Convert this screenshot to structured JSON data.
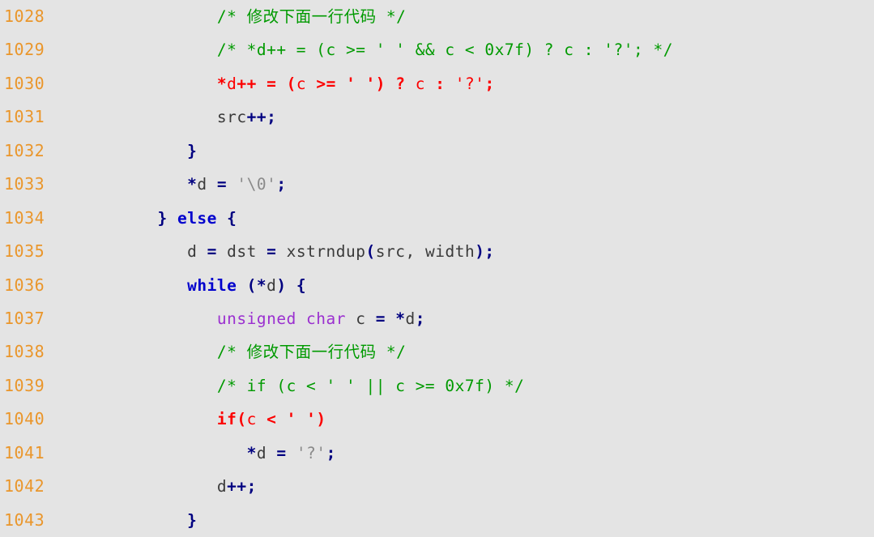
{
  "editor": {
    "name": "source-code-view",
    "background_color": "#e4e4e4",
    "gutter_color": "#ea962b",
    "font": "monospace",
    "first_line": 1028,
    "last_line": 1043,
    "colors": {
      "comment": "#009a00",
      "highlight": "#fc0000",
      "operator": "#000080",
      "keyword": "#0000cd",
      "type": "#9b30d0",
      "string": "#8a8a8a",
      "identifier": "#3a3a3a",
      "line_number": "#ea962b",
      "background": "#e4e4e4"
    }
  },
  "lines": [
    {
      "number": "1028",
      "text": "            /* 修改下面一行代码 */",
      "tokens": [
        {
          "t": "            ",
          "c": "plain"
        },
        {
          "t": "/* 修改下面一行代码 */",
          "c": "comment"
        }
      ]
    },
    {
      "number": "1029",
      "text": "            /* *d++ = (c >= ' ' && c < 0x7f) ? c : '?'; */",
      "tokens": [
        {
          "t": "            ",
          "c": "plain"
        },
        {
          "t": "/* *d++ = (c >= ' ' && c < 0x7f) ? c : '?'; */",
          "c": "comment"
        }
      ]
    },
    {
      "number": "1030",
      "text": "            *d++ = (c >= ' ') ? c : '?';",
      "tokens": [
        {
          "t": "            ",
          "c": "plain"
        },
        {
          "t": "*",
          "c": "redb"
        },
        {
          "t": "d",
          "c": "red"
        },
        {
          "t": "++ = (",
          "c": "redb"
        },
        {
          "t": "c ",
          "c": "red"
        },
        {
          "t": ">=",
          "c": "redb"
        },
        {
          "t": " ",
          "c": "red"
        },
        {
          "t": "' ')",
          "c": "redb"
        },
        {
          "t": " ",
          "c": "red"
        },
        {
          "t": "?",
          "c": "redb"
        },
        {
          "t": " c ",
          "c": "red"
        },
        {
          "t": ":",
          "c": "redb"
        },
        {
          "t": " '?'",
          "c": "red"
        },
        {
          "t": ";",
          "c": "redb"
        }
      ]
    },
    {
      "number": "1031",
      "text": "            src++;",
      "tokens": [
        {
          "t": "            ",
          "c": "plain"
        },
        {
          "t": "src",
          "c": "id"
        },
        {
          "t": "++;",
          "c": "op"
        }
      ]
    },
    {
      "number": "1032",
      "text": "         }",
      "tokens": [
        {
          "t": "         ",
          "c": "plain"
        },
        {
          "t": "}",
          "c": "op"
        }
      ]
    },
    {
      "number": "1033",
      "text": "         *d = '\\0';",
      "tokens": [
        {
          "t": "         ",
          "c": "plain"
        },
        {
          "t": "*",
          "c": "op"
        },
        {
          "t": "d ",
          "c": "id"
        },
        {
          "t": "=",
          "c": "op"
        },
        {
          "t": " ",
          "c": "plain"
        },
        {
          "t": "'\\0'",
          "c": "str"
        },
        {
          "t": ";",
          "c": "op"
        }
      ]
    },
    {
      "number": "1034",
      "text": "      } else {",
      "tokens": [
        {
          "t": "      ",
          "c": "plain"
        },
        {
          "t": "}",
          "c": "op"
        },
        {
          "t": " ",
          "c": "plain"
        },
        {
          "t": "else",
          "c": "kw"
        },
        {
          "t": " ",
          "c": "plain"
        },
        {
          "t": "{",
          "c": "op"
        }
      ]
    },
    {
      "number": "1035",
      "text": "         d = dst = xstrndup(src, width);",
      "tokens": [
        {
          "t": "         ",
          "c": "plain"
        },
        {
          "t": "d ",
          "c": "id"
        },
        {
          "t": "=",
          "c": "op"
        },
        {
          "t": " dst ",
          "c": "id"
        },
        {
          "t": "=",
          "c": "op"
        },
        {
          "t": " xstrndup",
          "c": "id"
        },
        {
          "t": "(",
          "c": "op"
        },
        {
          "t": "src, width",
          "c": "id"
        },
        {
          "t": ");",
          "c": "op"
        }
      ]
    },
    {
      "number": "1036",
      "text": "         while (*d) {",
      "tokens": [
        {
          "t": "         ",
          "c": "plain"
        },
        {
          "t": "while",
          "c": "kw"
        },
        {
          "t": " ",
          "c": "plain"
        },
        {
          "t": "(*",
          "c": "op"
        },
        {
          "t": "d",
          "c": "id"
        },
        {
          "t": ") {",
          "c": "op"
        }
      ]
    },
    {
      "number": "1037",
      "text": "            unsigned char c = *d;",
      "tokens": [
        {
          "t": "            ",
          "c": "plain"
        },
        {
          "t": "unsigned char",
          "c": "type"
        },
        {
          "t": " c ",
          "c": "id"
        },
        {
          "t": "=",
          "c": "op"
        },
        {
          "t": " ",
          "c": "plain"
        },
        {
          "t": "*",
          "c": "op"
        },
        {
          "t": "d",
          "c": "id"
        },
        {
          "t": ";",
          "c": "op"
        }
      ]
    },
    {
      "number": "1038",
      "text": "            /* 修改下面一行代码 */",
      "tokens": [
        {
          "t": "            ",
          "c": "plain"
        },
        {
          "t": "/* 修改下面一行代码 */",
          "c": "comment"
        }
      ]
    },
    {
      "number": "1039",
      "text": "            /* if (c < ' ' || c >= 0x7f) */",
      "tokens": [
        {
          "t": "            ",
          "c": "plain"
        },
        {
          "t": "/* if (c < ' ' || c >= 0x7f) */",
          "c": "comment"
        }
      ]
    },
    {
      "number": "1040",
      "text": "            if(c < ' ')",
      "tokens": [
        {
          "t": "            ",
          "c": "plain"
        },
        {
          "t": "if(",
          "c": "redb"
        },
        {
          "t": "c ",
          "c": "red"
        },
        {
          "t": "<",
          "c": "redb"
        },
        {
          "t": " ",
          "c": "red"
        },
        {
          "t": "' ')",
          "c": "redb"
        }
      ]
    },
    {
      "number": "1041",
      "text": "               *d = '?';",
      "tokens": [
        {
          "t": "               ",
          "c": "plain"
        },
        {
          "t": "*",
          "c": "op"
        },
        {
          "t": "d ",
          "c": "id"
        },
        {
          "t": "=",
          "c": "op"
        },
        {
          "t": " ",
          "c": "plain"
        },
        {
          "t": "'?'",
          "c": "str"
        },
        {
          "t": ";",
          "c": "op"
        }
      ]
    },
    {
      "number": "1042",
      "text": "            d++;",
      "tokens": [
        {
          "t": "            ",
          "c": "plain"
        },
        {
          "t": "d",
          "c": "id"
        },
        {
          "t": "++;",
          "c": "op"
        }
      ]
    },
    {
      "number": "1043",
      "text": "         }",
      "tokens": [
        {
          "t": "         ",
          "c": "plain"
        },
        {
          "t": "}",
          "c": "op"
        }
      ]
    }
  ]
}
